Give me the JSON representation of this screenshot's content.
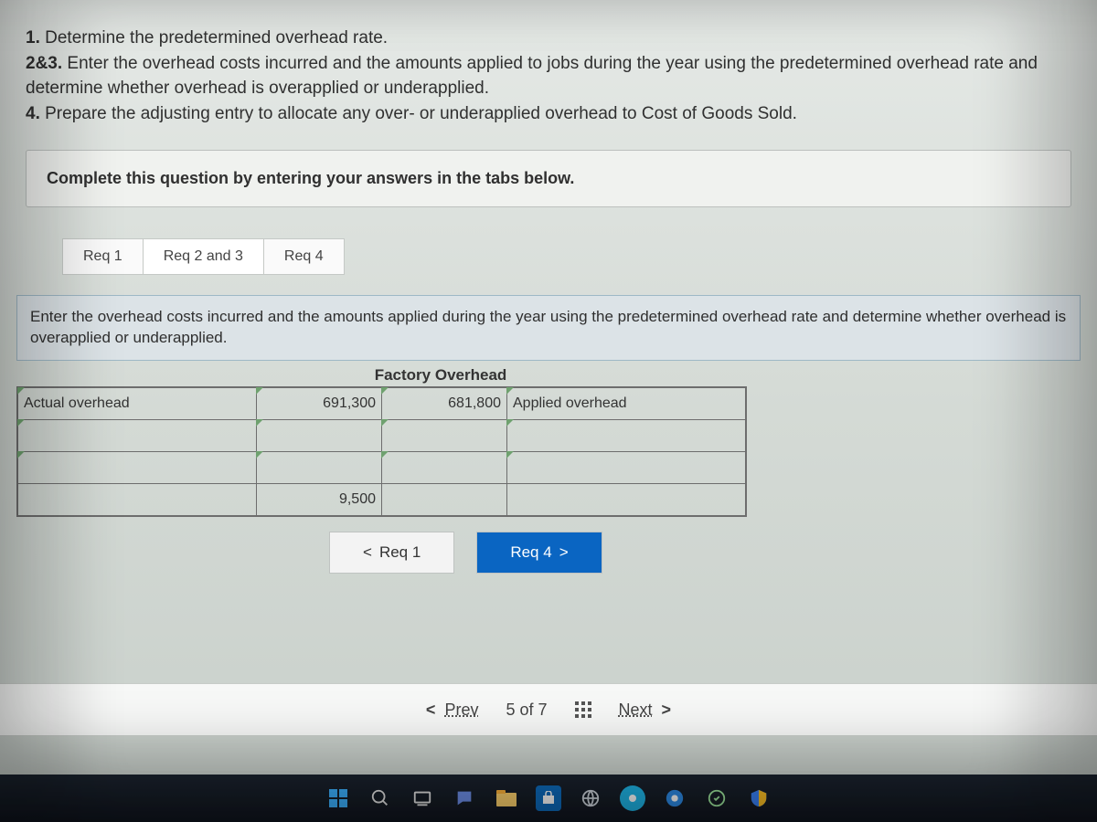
{
  "question": {
    "line1_num": "1.",
    "line1_text": " Determine the predetermined overhead rate.",
    "line2_num": "2&3.",
    "line2_text": " Enter the overhead costs incurred and the amounts applied to jobs during the year using the predetermined overhead rate and determine whether overhead is overapplied or underapplied.",
    "line3_num": "4.",
    "line3_text": " Prepare the adjusting entry to allocate any over- or underapplied overhead to Cost of Goods Sold."
  },
  "instruction": "Complete this question by entering your answers in the tabs below.",
  "tabs": [
    {
      "label": "Req 1",
      "active": false
    },
    {
      "label": "Req 2 and 3",
      "active": true
    },
    {
      "label": "Req 4",
      "active": false
    }
  ],
  "prompt": "Enter the overhead costs incurred and the amounts applied during the year using the predetermined overhead rate and determine whether overhead is overapplied or underapplied.",
  "t_account": {
    "title": "Factory Overhead",
    "rows": [
      {
        "debit_label": "Actual overhead",
        "debit_amt": "691,300",
        "credit_amt": "681,800",
        "credit_label": "Applied overhead"
      },
      {
        "debit_label": "",
        "debit_amt": "",
        "credit_amt": "",
        "credit_label": ""
      },
      {
        "debit_label": "",
        "debit_amt": "",
        "credit_amt": "",
        "credit_label": ""
      },
      {
        "debit_label": "",
        "debit_amt": "9,500",
        "credit_amt": "",
        "credit_label": ""
      }
    ]
  },
  "sub_nav": {
    "prev": "Req 1",
    "next": "Req 4"
  },
  "pager": {
    "prev": "Prev",
    "position": "5 of 7",
    "next": "Next"
  }
}
